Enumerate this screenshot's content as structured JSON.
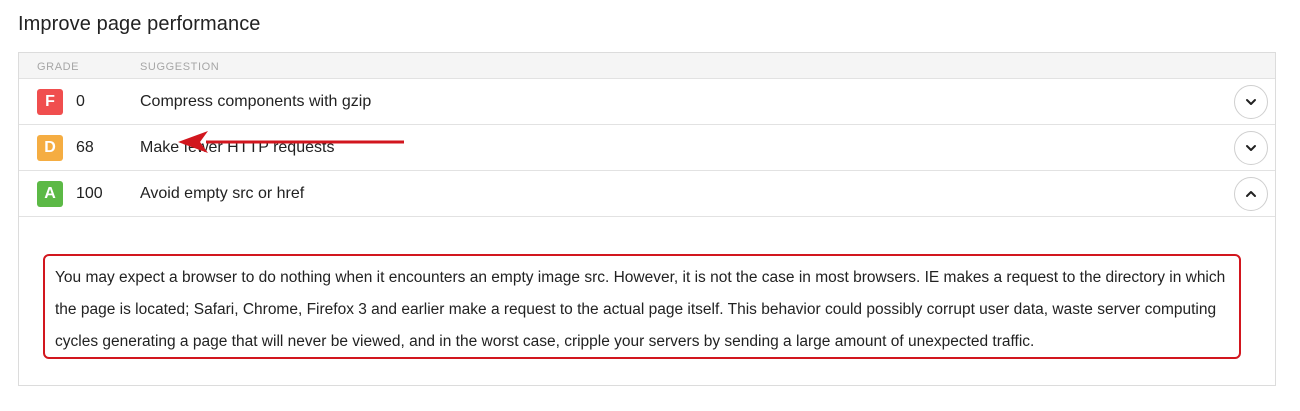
{
  "section_title": "Improve page performance",
  "table": {
    "headers": {
      "grade": "GRADE",
      "suggestion": "SUGGESTION"
    },
    "rows": [
      {
        "grade": "F",
        "score": "0",
        "suggestion": "Compress components with gzip",
        "grade_color": "#f04e4e",
        "expanded": false
      },
      {
        "grade": "D",
        "score": "68",
        "suggestion": "Make fewer HTTP requests",
        "grade_color": "#f5ad42",
        "expanded": false
      },
      {
        "grade": "A",
        "score": "100",
        "suggestion": "Avoid empty src or href",
        "grade_color": "#5cb946",
        "expanded": true
      }
    ],
    "expanded_description": "You may expect a browser to do nothing when it encounters an empty image src. However, it is not the case in most browsers. IE makes a request to the directory in which the page is located; Safari, Chrome, Firefox 3 and earlier make a request to the actual page itself. This behavior could possibly corrupt user data, waste server computing cycles generating a page that will never be viewed, and in the worst case, cripple your servers by sending a large amount of unexpected traffic."
  },
  "annotations": {
    "highlight_color": "#d2161e",
    "arrow_icon": "arrow-left-icon"
  },
  "icons": {
    "collapsed": "chevron-down-icon",
    "expanded": "chevron-up-icon"
  }
}
